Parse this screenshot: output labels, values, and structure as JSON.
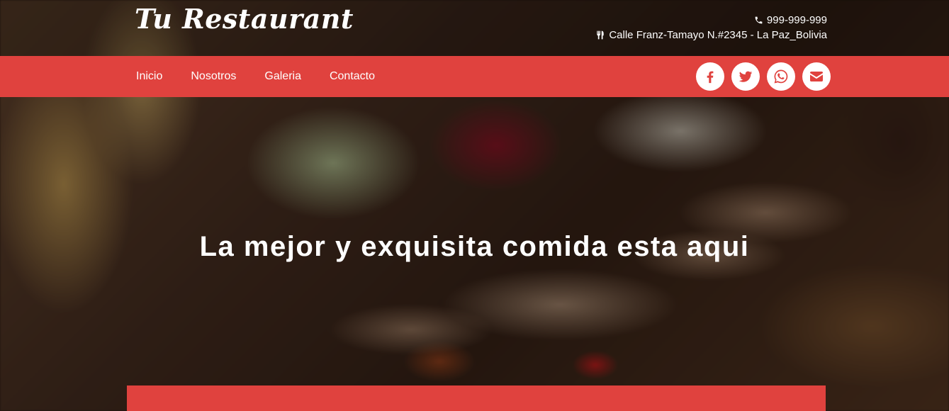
{
  "brand": {
    "logo_text": "Tu Restaurant"
  },
  "contact": {
    "phone": "999-999-999",
    "phone_icon": "phone-icon",
    "address": "Calle Franz-Tamayo N.#2345 - La Paz_Bolivia",
    "address_icon": "cutlery-icon"
  },
  "nav": {
    "items": [
      {
        "label": "Inicio"
      },
      {
        "label": "Nosotros"
      },
      {
        "label": "Galeria"
      },
      {
        "label": "Contacto"
      }
    ]
  },
  "social": {
    "items": [
      {
        "name": "facebook-icon"
      },
      {
        "name": "twitter-icon"
      },
      {
        "name": "whatsapp-icon"
      },
      {
        "name": "envelope-icon"
      }
    ]
  },
  "hero": {
    "title": "La mejor y exquisita comida esta aqui"
  },
  "colors": {
    "accent": "#e0423e",
    "text": "#ffffff"
  }
}
